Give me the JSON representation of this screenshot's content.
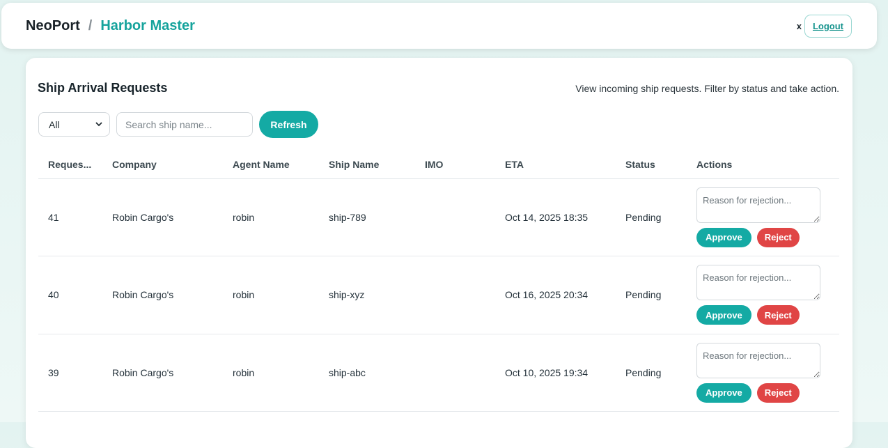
{
  "header": {
    "app_name": "NeoPort",
    "separator": "/",
    "role": "Harbor Master",
    "close_glyph": "x",
    "logout_label": "Logout"
  },
  "card": {
    "title": "Ship Arrival Requests",
    "description": "View incoming ship requests. Filter by status and take action."
  },
  "filters": {
    "status_selected": "All",
    "search_placeholder": "Search ship name...",
    "search_value": "",
    "refresh_label": "Refresh"
  },
  "table": {
    "columns": [
      "Reques...",
      "Company",
      "Agent Name",
      "Ship Name",
      "IMO",
      "ETA",
      "Status",
      "Actions"
    ],
    "rows": [
      {
        "id": "41",
        "company": "Robin Cargo's",
        "agent": "robin",
        "ship": "ship-789",
        "imo": "",
        "eta": "Oct 14, 2025 18:35",
        "status": "Pending"
      },
      {
        "id": "40",
        "company": "Robin Cargo's",
        "agent": "robin",
        "ship": "ship-xyz",
        "imo": "",
        "eta": "Oct 16, 2025 20:34",
        "status": "Pending"
      },
      {
        "id": "39",
        "company": "Robin Cargo's",
        "agent": "robin",
        "ship": "ship-abc",
        "imo": "",
        "eta": "Oct 10, 2025 19:34",
        "status": "Pending"
      }
    ],
    "reason_placeholder": "Reason for rejection...",
    "approve_label": "Approve",
    "reject_label": "Reject"
  },
  "colors": {
    "accent": "#14aaa4",
    "danger": "#e04545",
    "background": "#e3f3f1"
  },
  "icons": {
    "select_arrow": "chevron-down-icon"
  }
}
